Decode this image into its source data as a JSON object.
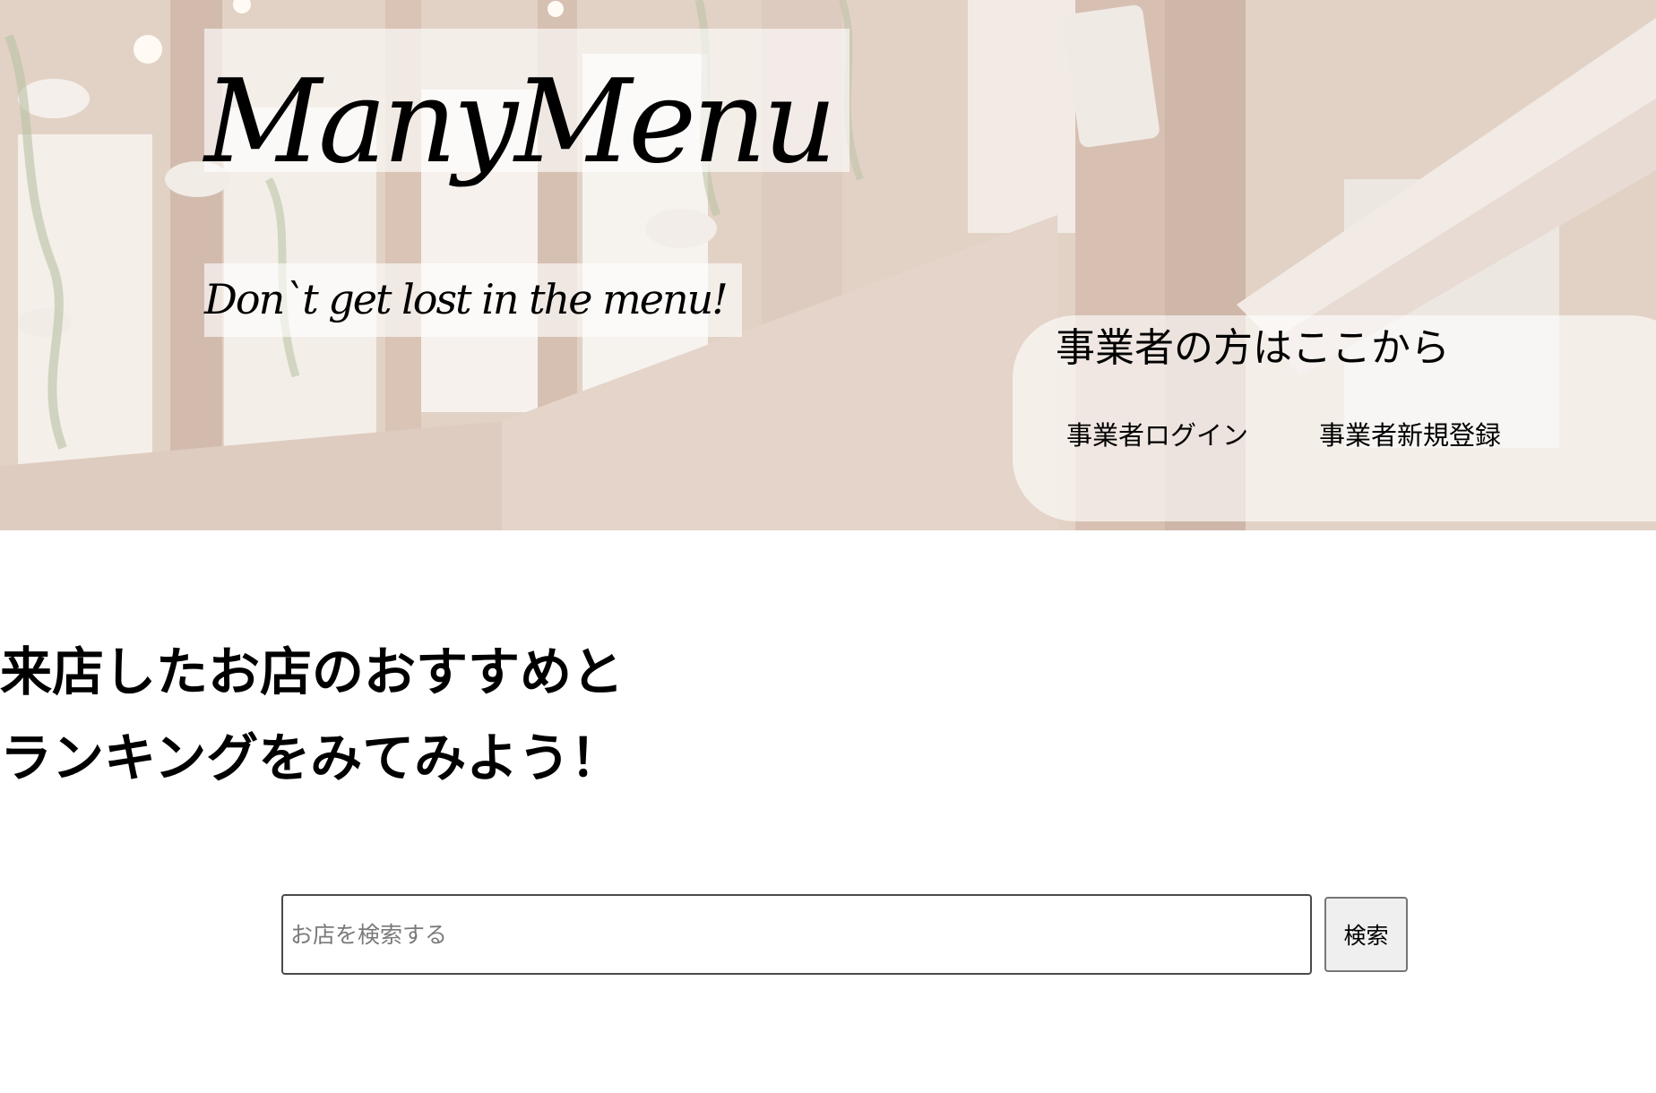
{
  "header": {
    "logo_text": "ManyMenu",
    "tagline": "Don`t get lost in the menu!",
    "background_image": "restaurant-interior-photo"
  },
  "business": {
    "heading": "事業者の方はここから",
    "login_label": "事業者ログイン",
    "register_label": "事業者新規登録"
  },
  "intro": {
    "line1": "来店したお店のおすすめと",
    "line2": "ランキングをみてみよう！"
  },
  "search": {
    "placeholder": "お店を検索する",
    "value": "",
    "button_label": "検索"
  }
}
